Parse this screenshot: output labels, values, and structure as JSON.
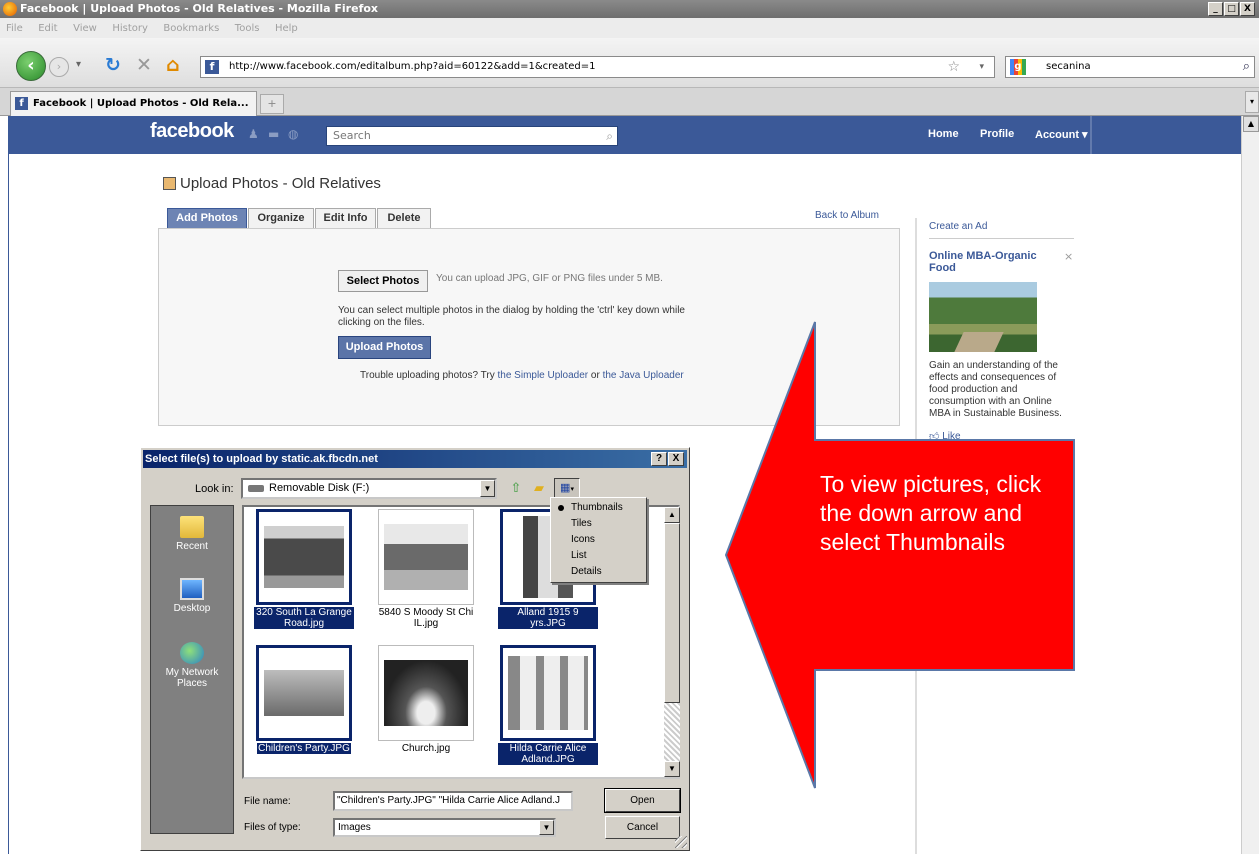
{
  "window": {
    "title": "Facebook | Upload Photos - Old Relatives - Mozilla Firefox",
    "controls": [
      "_",
      "□",
      "X"
    ]
  },
  "menu": [
    "File",
    "Edit",
    "View",
    "History",
    "Bookmarks",
    "Tools",
    "Help"
  ],
  "browser": {
    "url": "http://www.facebook.com/editalbum.php?aid=60122&add=1&created=1",
    "search_value": "secanina",
    "tab_title": "Facebook | Upload Photos - Old Rela...",
    "new_tab": "+",
    "fb_favicon": "f"
  },
  "fb_header": {
    "logo": "facebook",
    "search_placeholder": "Search",
    "nav": [
      "Home",
      "Profile",
      "Account ▾"
    ]
  },
  "page": {
    "title": "Upload Photos - Old Relatives",
    "tabs": [
      "Add Photos",
      "Organize",
      "Edit Info",
      "Delete"
    ],
    "back_link": "Back to Album",
    "select_button": "Select Photos",
    "select_hint": "You can upload JPG, GIF or PNG files under 5 MB.",
    "multi_hint": "You can select multiple photos in the dialog by holding the 'ctrl' key down while clicking on the files.",
    "upload_button": "Upload Photos",
    "trouble_prefix": "Trouble uploading photos? Try ",
    "simple_uploader": "the Simple Uploader",
    "trouble_or": " or ",
    "java_uploader": "the Java Uploader"
  },
  "sidebar": {
    "create_ad": "Create an Ad",
    "ad_title": "Online MBA-Organic Food",
    "ad_close": "×",
    "ad_body": "Gain an understanding of the effects and consequences of food production and consumption with an Online MBA in Sustainable Business.",
    "like": "Like"
  },
  "dialog": {
    "title": "Select file(s) to upload by static.ak.fbcdn.net",
    "help": "?",
    "close": "X",
    "look_in_label": "Look in:",
    "look_in_value": "Removable Disk (F:)",
    "places": [
      "Recent",
      "Desktop",
      "My Network Places"
    ],
    "files": [
      {
        "name": "320 South La Grange Road.jpg",
        "selected": true
      },
      {
        "name": "5840 S Moody St Chi IL.jpg",
        "selected": false
      },
      {
        "name": "Alland 1915 9 yrs.JPG",
        "selected": true
      },
      {
        "name": "Children's Party.JPG",
        "selected": true
      },
      {
        "name": "Church.jpg",
        "selected": false
      },
      {
        "name": "Hilda Carrie Alice Adland.JPG",
        "selected": true
      }
    ],
    "file_name_label": "File name:",
    "file_name_value": "\"Children's Party.JPG\" \"Hilda Carrie Alice Adland.J",
    "file_type_label": "Files of type:",
    "file_type_value": "Images",
    "open_button": "Open",
    "cancel_button": "Cancel"
  },
  "view_menu": {
    "items": [
      "Thumbnails",
      "Tiles",
      "Icons",
      "List",
      "Details"
    ],
    "checked": "Thumbnails"
  },
  "callout": {
    "text": "To view pictures, click the down arrow and select Thumbnails",
    "color": "#ff0000"
  },
  "colors": {
    "fb_blue": "#3b5998",
    "selection": "#0a246a"
  }
}
